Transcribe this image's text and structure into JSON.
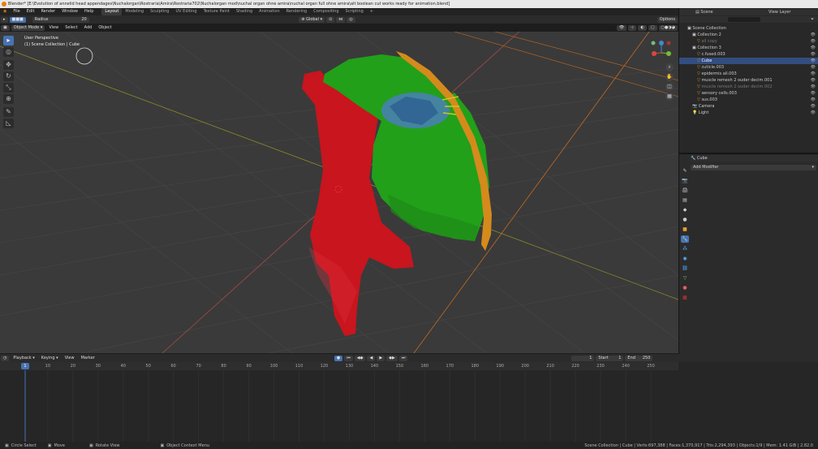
{
  "window": {
    "title": "Blender* [E:\\Evolution of annelid head appendages\\Nuchalorgan\\Rostraria\\Amira\\Rostraria702\\Nuchalorgan mod\\nuchal organ ohne amira\\nuchal organ full ohne amira\\alt boolean cut works ready for animation.blend]"
  },
  "menu": [
    "File",
    "Edit",
    "Render",
    "Window",
    "Help"
  ],
  "workspaces": [
    "Layout",
    "Modeling",
    "Sculpting",
    "UV Editing",
    "Texture Paint",
    "Shading",
    "Animation",
    "Rendering",
    "Compositing",
    "Scripting"
  ],
  "active_workspace": "Layout",
  "viewport_header": {
    "mode": "Object Mode",
    "menus": [
      "View",
      "Select",
      "Add",
      "Object"
    ],
    "orientation": "Global",
    "select_box": "Options"
  },
  "tool_header": {
    "label": "Radius",
    "value": "20"
  },
  "viewport": {
    "perspective": "User Perspective",
    "collection_info": "(1) Scene Collection | Cube"
  },
  "outliner": {
    "scene_label": "Scene",
    "view_layer_label": "View Layer",
    "root": "Scene Collection",
    "items": [
      {
        "name": "Collection 2",
        "indent": 1,
        "selected": false,
        "dim": false
      },
      {
        "name": "all copy",
        "indent": 2,
        "selected": false,
        "dim": true
      },
      {
        "name": "Collection 3",
        "indent": 1,
        "selected": false,
        "dim": false
      },
      {
        "name": "c.fused.003",
        "indent": 2,
        "selected": false,
        "dim": false
      },
      {
        "name": "Cube",
        "indent": 2,
        "selected": true,
        "dim": false
      },
      {
        "name": "cuticle.003",
        "indent": 2,
        "selected": false,
        "dim": false
      },
      {
        "name": "epidermis all.003",
        "indent": 2,
        "selected": false,
        "dim": false
      },
      {
        "name": "muscle remesh 2 ouder decim.001",
        "indent": 2,
        "selected": false,
        "dim": false
      },
      {
        "name": "muscle remesh 2 ouder decim.002",
        "indent": 2,
        "selected": false,
        "dim": true
      },
      {
        "name": "sensory cells.003",
        "indent": 2,
        "selected": false,
        "dim": false
      },
      {
        "name": "sus.003",
        "indent": 2,
        "selected": false,
        "dim": false
      },
      {
        "name": "Camera",
        "indent": 1,
        "selected": false,
        "dim": false
      },
      {
        "name": "Light",
        "indent": 1,
        "selected": false,
        "dim": false
      }
    ]
  },
  "properties": {
    "object_name": "Cube",
    "add_modifier": "Add Modifier"
  },
  "timeline": {
    "menus": [
      "Playback",
      "Keying",
      "View",
      "Marker"
    ],
    "current_frame": "1",
    "start_label": "Start",
    "start_value": "1",
    "end_label": "End",
    "end_value": "250",
    "ticks": [
      "1",
      "10",
      "20",
      "30",
      "40",
      "50",
      "60",
      "70",
      "80",
      "90",
      "100",
      "110",
      "120",
      "130",
      "140",
      "150",
      "160",
      "170",
      "180",
      "190",
      "200",
      "210",
      "220",
      "230",
      "240",
      "250"
    ]
  },
  "statusbar": {
    "left": [
      "Circle Select",
      "Move",
      "Rotate View",
      "Object Context Menu"
    ],
    "right": "Scene Collection | Cube | Verts:697,388 | Faces:1,370,917 | Tris:2,294,393 | Objects:1/9 | Mem: 1.41 GiB | 2.82.0"
  },
  "colors": {
    "accent": "#4772b3",
    "muscle": "#c8151e",
    "epidermis": "#22a01a",
    "cuticle": "#d58a1c",
    "nerve": "#4a7fb8"
  }
}
